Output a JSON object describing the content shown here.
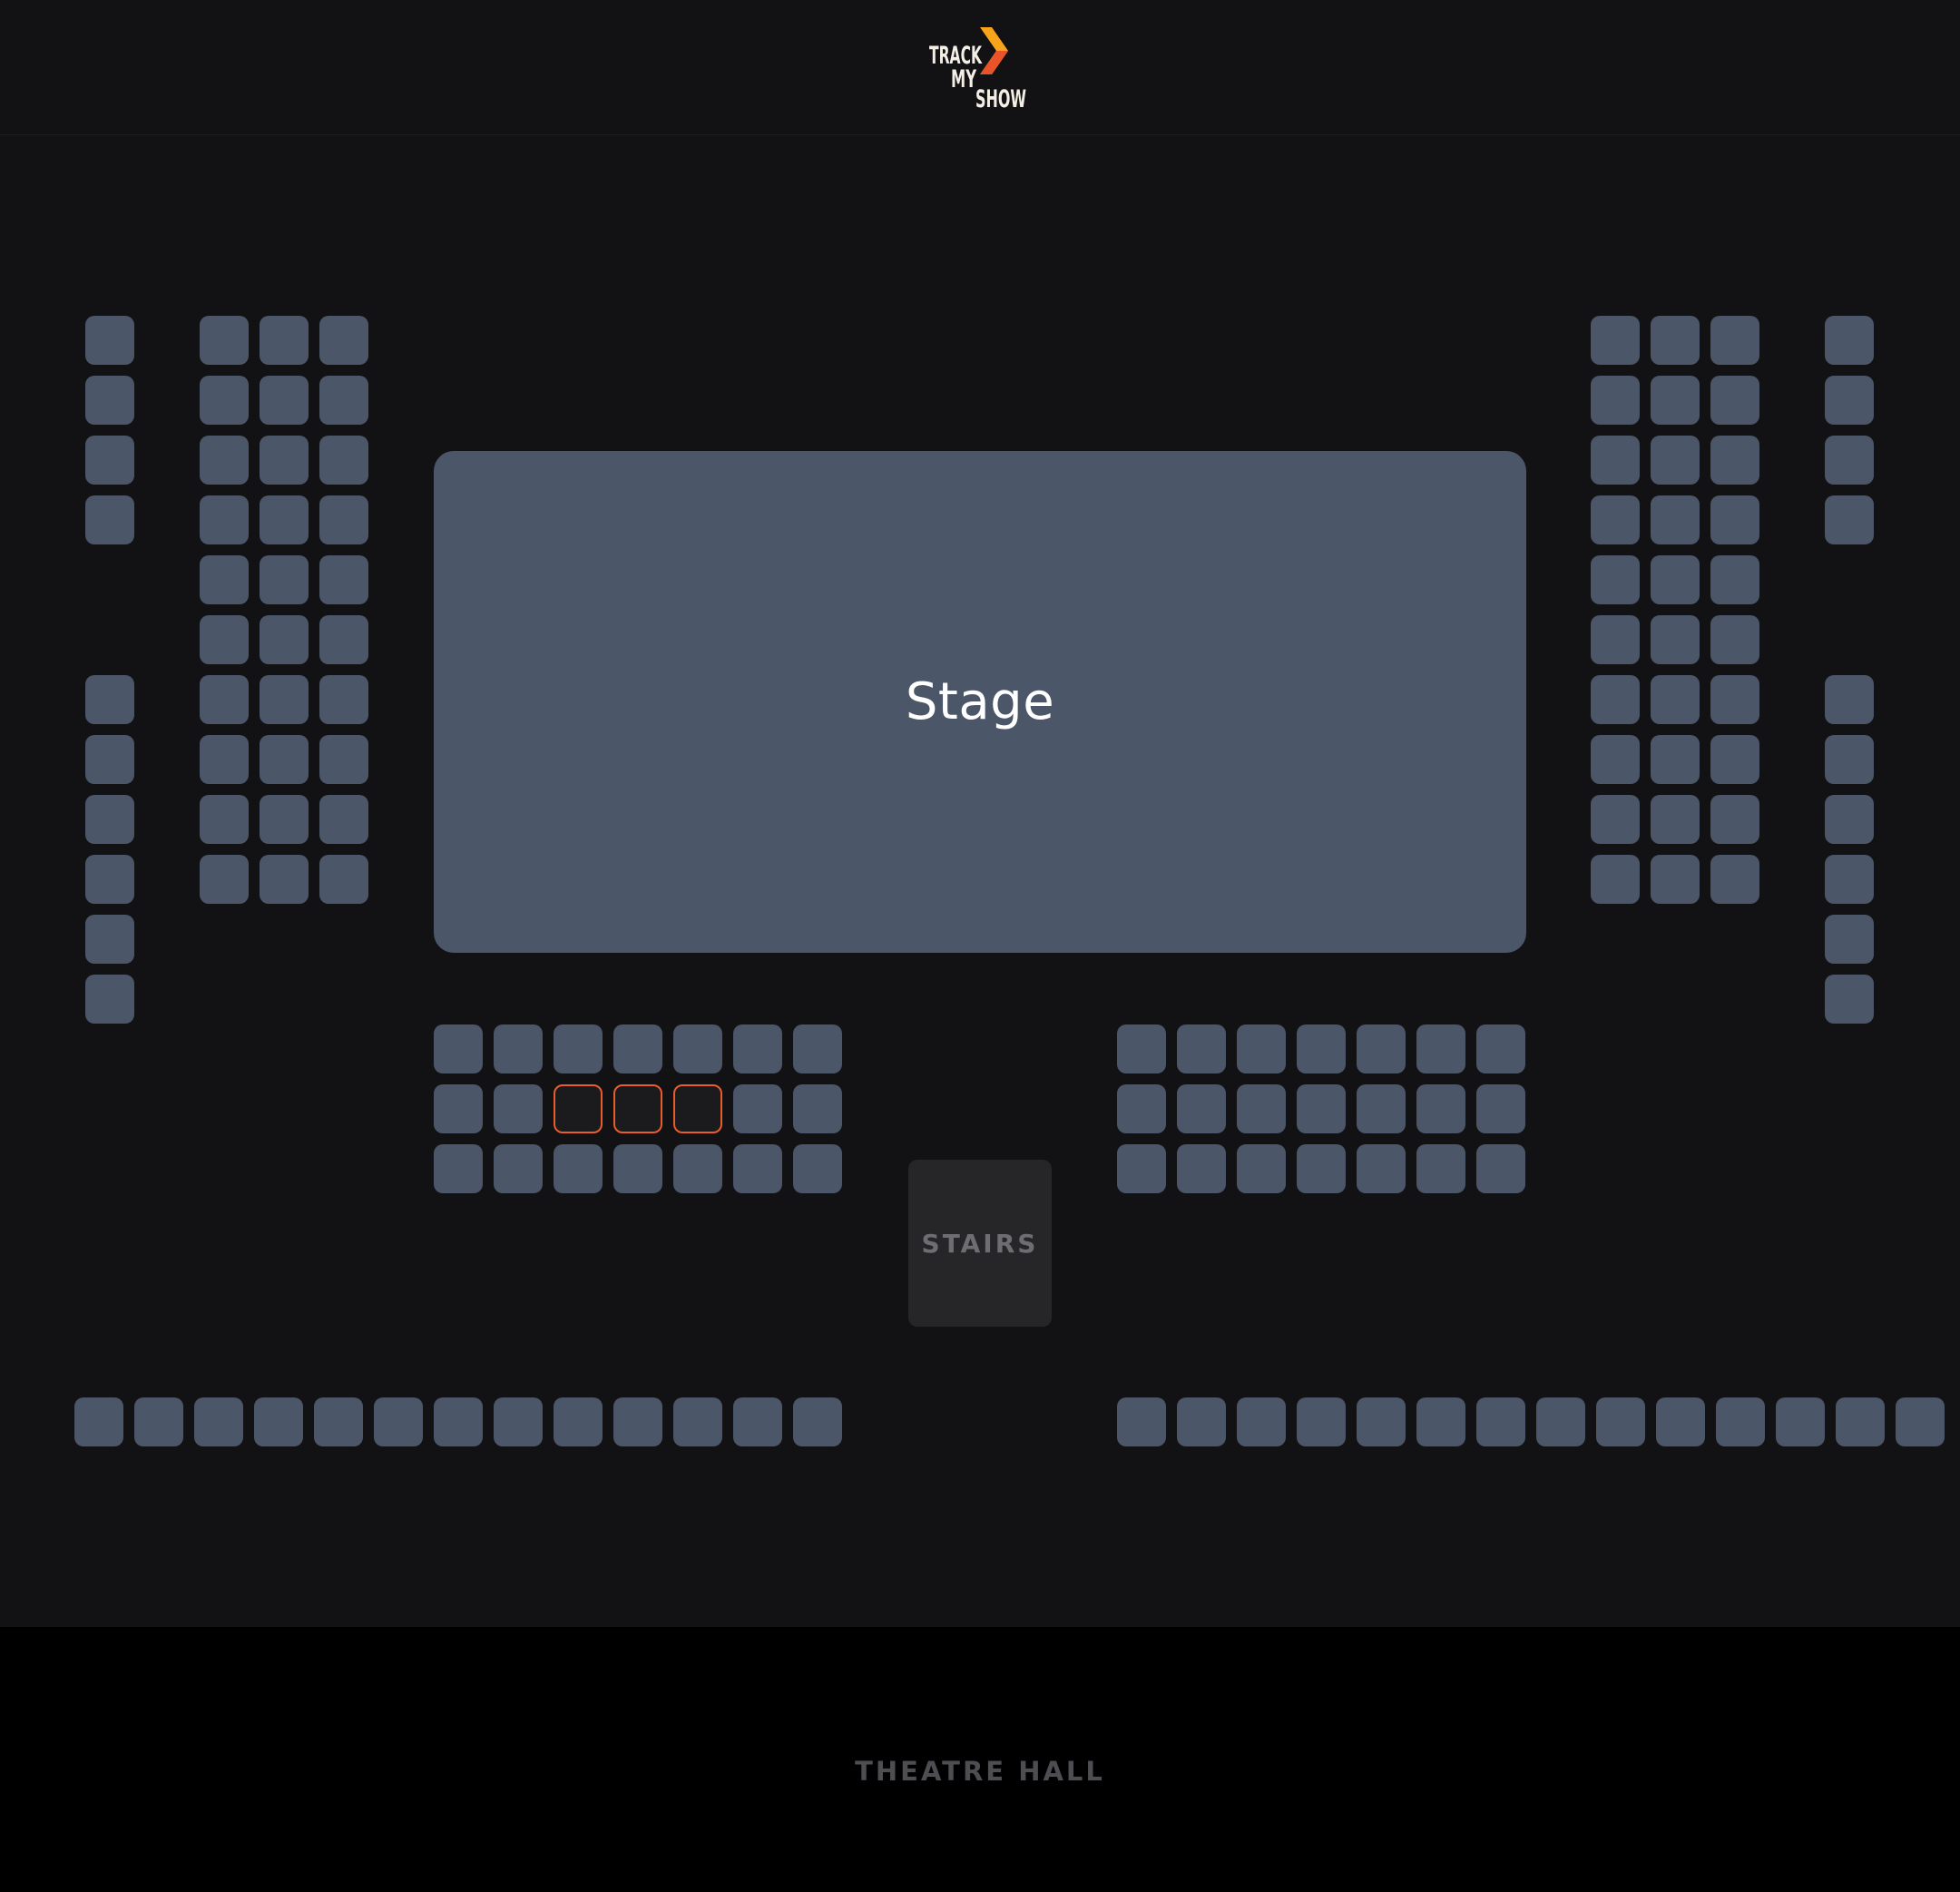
{
  "app": {
    "logo_lines": [
      "TRACK",
      "MY",
      "SHOW"
    ],
    "logo_accent_colors": [
      "#f7a41c",
      "#e8532a"
    ]
  },
  "venue": {
    "stage_label": "Stage",
    "stairs_label": "STAIRS",
    "hall_label": "THEATRE HALL"
  },
  "legend_colors": {
    "available": "#4b5668",
    "selected_border": "#e85d2c",
    "background": "#121113"
  },
  "seating": {
    "blocks": [
      {
        "id": "left-outer-top",
        "rows": 4,
        "cols": 1
      },
      {
        "id": "left-outer-bottom",
        "rows": 6,
        "cols": 1
      },
      {
        "id": "left-side",
        "rows": 10,
        "cols": 3
      },
      {
        "id": "right-side",
        "rows": 10,
        "cols": 3
      },
      {
        "id": "right-outer-top",
        "rows": 4,
        "cols": 1
      },
      {
        "id": "right-outer-bottom",
        "rows": 6,
        "cols": 1
      },
      {
        "id": "center-left",
        "rows": 3,
        "cols": 7,
        "selected": [
          [
            1,
            2
          ],
          [
            1,
            3
          ],
          [
            1,
            4
          ]
        ]
      },
      {
        "id": "center-right",
        "rows": 3,
        "cols": 7
      },
      {
        "id": "back-left",
        "rows": 1,
        "cols": 13
      },
      {
        "id": "back-right",
        "rows": 1,
        "cols": 14
      }
    ],
    "selected_count": 3
  }
}
